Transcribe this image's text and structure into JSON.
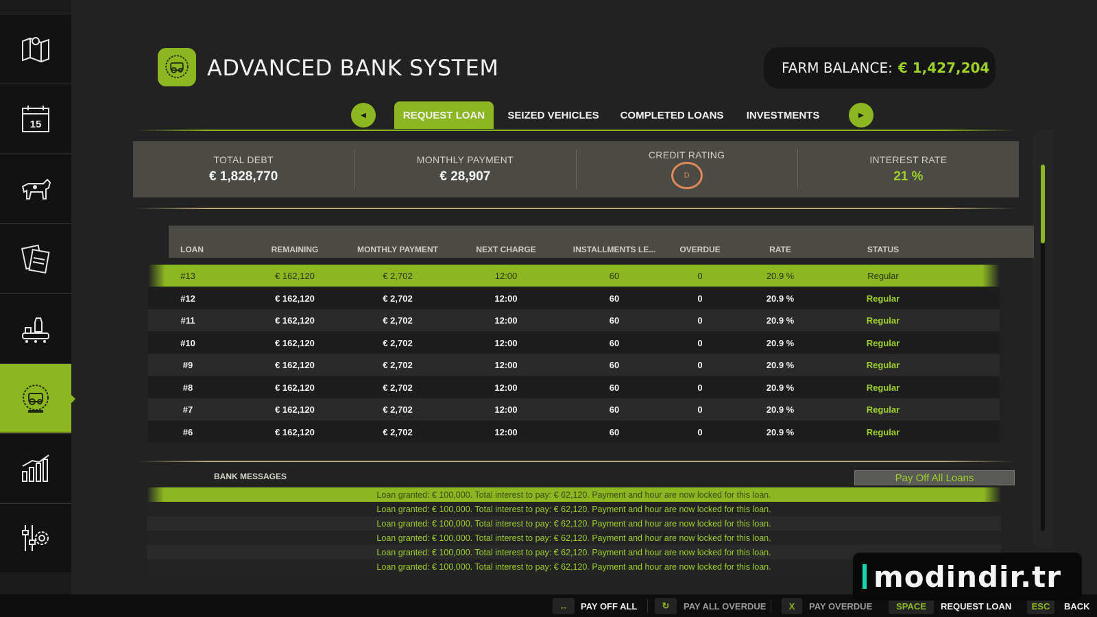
{
  "header": {
    "title": "ADVANCED BANK SYSTEM",
    "balance_label": "FARM BALANCE:",
    "balance_value": "€ 1,427,204"
  },
  "tabs": [
    {
      "label": "REQUEST LOAN",
      "active": true
    },
    {
      "label": "SEIZED VEHICLES",
      "active": false
    },
    {
      "label": "COMPLETED LOANS",
      "active": false
    },
    {
      "label": "INVESTMENTS",
      "active": false
    }
  ],
  "summary": {
    "total_debt_label": "TOTAL DEBT",
    "total_debt_value": "€ 1,828,770",
    "monthly_payment_label": "MONTHLY PAYMENT",
    "monthly_payment_value": "€ 28,907",
    "credit_rating_label": "CREDIT RATING",
    "credit_rating_value": "D",
    "interest_rate_label": "INTEREST RATE",
    "interest_rate_value": "21 %"
  },
  "table": {
    "headers": [
      "LOAN",
      "REMAINING",
      "MONTHLY PAYMENT",
      "NEXT CHARGE",
      "INSTALLMENTS LE...",
      "OVERDUE",
      "RATE",
      "STATUS"
    ],
    "rows": [
      [
        "#13",
        "€ 162,120",
        "€ 2,702",
        "12:00",
        "60",
        "0",
        "20.9 %",
        "Regular"
      ],
      [
        "#12",
        "€ 162,120",
        "€ 2,702",
        "12:00",
        "60",
        "0",
        "20.9 %",
        "Regular"
      ],
      [
        "#11",
        "€ 162,120",
        "€ 2,702",
        "12:00",
        "60",
        "0",
        "20.9 %",
        "Regular"
      ],
      [
        "#10",
        "€ 162,120",
        "€ 2,702",
        "12:00",
        "60",
        "0",
        "20.9 %",
        "Regular"
      ],
      [
        "#9",
        "€ 162,120",
        "€ 2,702",
        "12:00",
        "60",
        "0",
        "20.9 %",
        "Regular"
      ],
      [
        "#8",
        "€ 162,120",
        "€ 2,702",
        "12:00",
        "60",
        "0",
        "20.9 %",
        "Regular"
      ],
      [
        "#7",
        "€ 162,120",
        "€ 2,702",
        "12:00",
        "60",
        "0",
        "20.9 %",
        "Regular"
      ],
      [
        "#6",
        "€ 162,120",
        "€ 2,702",
        "12:00",
        "60",
        "0",
        "20.9 %",
        "Regular"
      ]
    ]
  },
  "messages": {
    "title": "BANK MESSAGES",
    "pay_off_all_label": "Pay Off All Loans",
    "items": [
      "Loan granted: € 100,000. Total interest to pay: € 62,120. Payment and hour are now locked for this loan.",
      "Loan granted: € 100,000. Total interest to pay: € 62,120. Payment and hour are now locked for this loan.",
      "Loan granted: € 100,000. Total interest to pay: € 62,120. Payment and hour are now locked for this loan.",
      "Loan granted: € 100,000. Total interest to pay: € 62,120. Payment and hour are now locked for this loan.",
      "Loan granted: € 100,000. Total interest to pay: € 62,120. Payment and hour are now locked for this loan.",
      "Loan granted: € 100,000. Total interest to pay: € 62,120. Payment and hour are now locked for this loan."
    ]
  },
  "footer": {
    "pay_off_all": "PAY OFF ALL",
    "pay_all_overdue": "PAY ALL OVERDUE",
    "pay_overdue_key": "X",
    "pay_overdue": "PAY OVERDUE",
    "request_loan_key": "SPACE",
    "request_loan": "REQUEST LOAN",
    "back_key": "ESC",
    "back": "BACK"
  },
  "sidebar": {
    "items": [
      {
        "icon": "map-icon"
      },
      {
        "icon": "calendar-icon",
        "text": "15"
      },
      {
        "icon": "cow-icon"
      },
      {
        "icon": "documents-icon"
      },
      {
        "icon": "production-icon"
      },
      {
        "icon": "bank-logo-icon",
        "active": true
      },
      {
        "icon": "statistics-icon"
      },
      {
        "icon": "settings-icon"
      }
    ]
  },
  "watermark": "modindir.tr",
  "colors": {
    "accent": "#8cb721",
    "accent_text": "#9ed12a",
    "rating": "#e08a5a"
  }
}
